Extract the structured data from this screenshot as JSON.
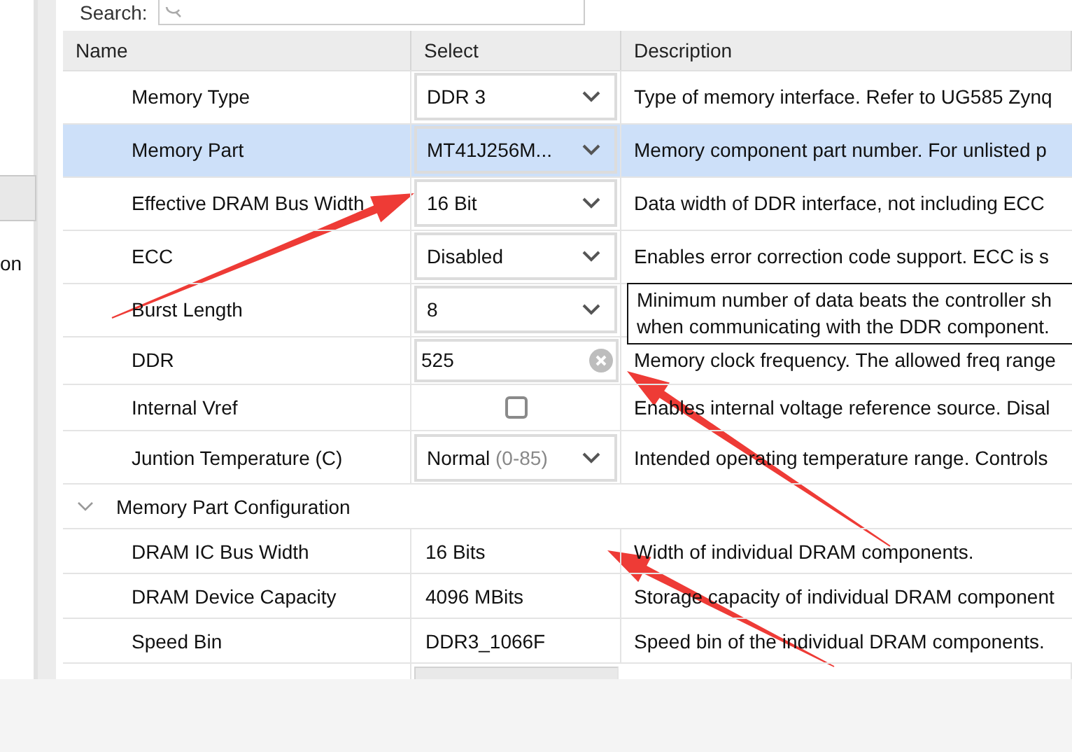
{
  "left_panel": {
    "text": "on"
  },
  "search": {
    "label": "Search:"
  },
  "table": {
    "columns": [
      "Name",
      "Select",
      "Description"
    ],
    "rows": [
      {
        "kind": "dropdown",
        "name": "Memory Type",
        "value": "DDR 3",
        "description": "Type of memory interface. Refer to UG585 Zynq",
        "selected": false
      },
      {
        "kind": "dropdown",
        "name": "Memory Part",
        "value": "MT41J256M...",
        "description": "Memory component part number. For unlisted p",
        "selected": true
      },
      {
        "kind": "dropdown",
        "name": "Effective DRAM Bus Width",
        "value": "16 Bit",
        "description": "Data width of DDR interface, not including ECC",
        "selected": false
      },
      {
        "kind": "dropdown",
        "name": "ECC",
        "value": "Disabled",
        "description": "Enables error correction code support. ECC is s",
        "selected": false
      },
      {
        "kind": "dropdown",
        "name": "Burst Length",
        "value": "8",
        "description": "",
        "selected": false
      },
      {
        "kind": "text-field",
        "name": "DDR",
        "value": "525",
        "description": "Memory clock frequency. The allowed freq range",
        "selected": false
      },
      {
        "kind": "checkbox",
        "name": "Internal Vref",
        "checked": false,
        "description": "Enables internal voltage reference source. Disal",
        "selected": false
      },
      {
        "kind": "dropdown",
        "name": "Juntion Temperature (C)",
        "value": "Normal",
        "hint": "(0-85)",
        "description": "Intended operating temperature range. Controls",
        "selected": false
      },
      {
        "kind": "group",
        "name": "Memory Part Configuration",
        "expanded": true
      },
      {
        "kind": "static",
        "name": "DRAM IC Bus Width",
        "value": "16 Bits",
        "description": "Width of individual DRAM components.",
        "selected": false
      },
      {
        "kind": "static",
        "name": "DRAM Device Capacity",
        "value": "4096 MBits",
        "description": "Storage capacity of individual DRAM component",
        "selected": false
      },
      {
        "kind": "static",
        "name": "Speed Bin",
        "value": "DDR3_1066F",
        "description": "Speed bin of the individual DRAM components.",
        "selected": false
      }
    ]
  },
  "tooltip": {
    "lines": [
      "Minimum number of data beats the controller sh",
      "when communicating with the DDR component."
    ]
  }
}
